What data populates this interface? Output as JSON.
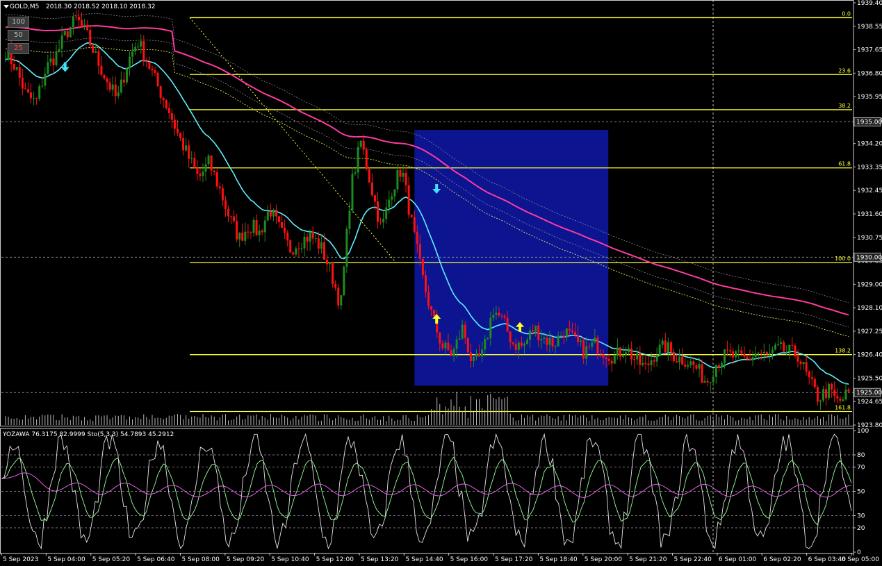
{
  "header": {
    "symbol": "GOLD,M5",
    "ohlc": "2018.30 2018.52 2018.10 2018.32"
  },
  "buttons": [
    {
      "label": "100",
      "color": "#999999"
    },
    {
      "label": "50",
      "color": "#999999"
    },
    {
      "label": "25",
      "color": "#ff4444"
    }
  ],
  "sub_header": {
    "text": "YOZAWA 76.3175 82.9999  Sto(5,3,3) 54.7893 45.2912"
  },
  "colors": {
    "bull": "#1f8a1f",
    "bear": "#ff1010",
    "fib": "#ffff33",
    "ma_fast": "#5ff0ff",
    "ma_slow": "#ff3aa0",
    "box": "#0c1490",
    "sto_main": "#9cff9c",
    "sto_signal": "#ff66ff",
    "osc": "#e6e6e6"
  },
  "chart_data": [
    {
      "type": "candlestick",
      "ylim": [
        1923.8,
        1939.4
      ],
      "y_ticks": [
        "1939.40",
        "1938.55",
        "1937.65",
        "1936.80",
        "1935.95",
        "1935.00",
        "1934.20",
        "1933.35",
        "1932.45",
        "1931.60",
        "1930.75",
        "1929.85",
        "1929.00",
        "1928.10",
        "1927.25",
        "1926.40",
        "1925.50",
        "1924.65",
        "1923.80"
      ],
      "price_boxes": [
        "1935.00",
        "1930.00",
        "1925.00"
      ],
      "x_ticks": [
        "5 Sep 2023",
        "5 Sep 04:00",
        "5 Sep 05:20",
        "5 Sep 06:40",
        "5 Sep 08:00",
        "5 Sep 09:20",
        "5 Sep 10:40",
        "5 Sep 12:00",
        "5 Sep 13:20",
        "5 Sep 14:40",
        "5 Sep 16:00",
        "5 Sep 17:20",
        "5 Sep 18:40",
        "5 Sep 20:00",
        "5 Sep 21:20",
        "5 Sep 22:40",
        "6 Sep 01:00",
        "6 Sep 02:20",
        "6 Sep 03:40",
        "6 Sep 05:00"
      ],
      "fib_levels": [
        {
          "label": "0.0",
          "price": 1938.85
        },
        {
          "label": "23.6",
          "price": 1936.75
        },
        {
          "label": "38.2",
          "price": 1935.45
        },
        {
          "label": "61.8",
          "price": 1933.3
        },
        {
          "label": "100.0",
          "price": 1929.8
        },
        {
          "label": "138.2",
          "price": 1926.4
        },
        {
          "label": "161.8",
          "price": 1924.3
        }
      ],
      "zone": {
        "price_top": 1934.7,
        "price_bottom": 1925.25
      },
      "path_points": [
        [
          1937.6,
          1937.45
        ],
        [
          1937.0,
          1937.2
        ],
        [
          1936.0,
          1936.2
        ],
        [
          1935.7,
          1935.9
        ],
        [
          1937.0,
          1937.3
        ],
        [
          1937.5,
          1937.7
        ],
        [
          1938.3,
          1938.5
        ],
        [
          1938.8,
          1938.9
        ],
        [
          1938.2,
          1938.0
        ],
        [
          1937.3,
          1937.1
        ],
        [
          1936.5,
          1936.4
        ],
        [
          1935.8,
          1935.7
        ],
        [
          1937.2,
          1937.4
        ],
        [
          1938.0,
          1938.1
        ],
        [
          1937.2,
          1937.0
        ],
        [
          1936.3,
          1936.1
        ],
        [
          1935.5,
          1935.3
        ],
        [
          1934.5,
          1934.3
        ],
        [
          1933.7,
          1933.5
        ],
        [
          1932.9,
          1932.8
        ],
        [
          1933.5,
          1933.6
        ],
        [
          1932.6,
          1932.4
        ],
        [
          1931.5,
          1931.3
        ],
        [
          1930.7,
          1930.5
        ],
        [
          1931.2,
          1931.4
        ],
        [
          1930.9,
          1930.6
        ],
        [
          1931.8,
          1931.9
        ],
        [
          1931.0,
          1930.8
        ],
        [
          1930.3,
          1930.1
        ],
        [
          1930.6,
          1930.7
        ],
        [
          1930.8,
          1930.9
        ],
        [
          1930.4,
          1930.3
        ],
        [
          1929.5,
          1929.3
        ],
        [
          1928.2,
          1928.0
        ],
        [
          1932.6,
          1932.9
        ],
        [
          1934.3,
          1934.1
        ],
        [
          1932.6,
          1932.5
        ],
        [
          1931.0,
          1930.8
        ],
        [
          1932.5,
          1932.7
        ],
        [
          1933.3,
          1933.2
        ],
        [
          1931.2,
          1931.0
        ],
        [
          1929.3,
          1929.1
        ],
        [
          1927.8,
          1927.6
        ],
        [
          1926.7,
          1926.5
        ],
        [
          1926.4,
          1926.3
        ],
        [
          1927.4,
          1927.6
        ],
        [
          1926.0,
          1925.8
        ],
        [
          1926.4,
          1926.6
        ],
        [
          1928.1,
          1928.3
        ],
        [
          1927.6,
          1927.7
        ],
        [
          1926.8,
          1926.9
        ],
        [
          1926.7,
          1926.8
        ],
        [
          1927.4,
          1927.5
        ],
        [
          1927.0,
          1927.1
        ],
        [
          1926.8,
          1926.9
        ],
        [
          1927.3,
          1927.4
        ],
        [
          1926.9,
          1926.8
        ],
        [
          1926.5,
          1926.6
        ],
        [
          1926.8,
          1926.7
        ],
        [
          1926.5,
          1926.4
        ],
        [
          1926.3,
          1926.4
        ],
        [
          1926.7,
          1926.9
        ],
        [
          1926.2,
          1926.1
        ],
        [
          1925.9,
          1926.0
        ],
        [
          1926.5,
          1926.6
        ],
        [
          1926.7,
          1926.9
        ],
        [
          1926.3,
          1926.2
        ],
        [
          1926.2,
          1926.3
        ],
        [
          1925.9,
          1925.8
        ],
        [
          1925.4,
          1925.5
        ],
        [
          1926.1,
          1926.2
        ],
        [
          1926.4,
          1926.5
        ],
        [
          1926.3,
          1926.4
        ],
        [
          1926.2,
          1926.3
        ],
        [
          1926.5,
          1926.6
        ],
        [
          1926.3,
          1926.4
        ],
        [
          1926.6,
          1926.7
        ],
        [
          1926.5,
          1926.4
        ],
        [
          1926.4,
          1926.5
        ],
        [
          1925.5,
          1925.4
        ],
        [
          1924.8,
          1924.9
        ],
        [
          1925.1,
          1925.2
        ],
        [
          1924.6,
          1924.7
        ],
        [
          1925.0,
          1925.2
        ]
      ],
      "arrows": [
        {
          "bar_frac": 0.075,
          "price": 1937.05,
          "dir": "down",
          "color": "#40e0ff"
        },
        {
          "bar_frac": 0.512,
          "price": 1932.55,
          "dir": "down",
          "color": "#40e0ff"
        },
        {
          "bar_frac": 0.512,
          "price": 1927.7,
          "dir": "up",
          "color": "#ffff22"
        },
        {
          "bar_frac": 0.61,
          "price": 1927.4,
          "dir": "up",
          "color": "#ffff22"
        }
      ]
    },
    {
      "type": "line",
      "name": "oscillator",
      "ylim": [
        0,
        100
      ],
      "y_ticks": [
        "100",
        "80",
        "70",
        "50",
        "30",
        "20",
        "0"
      ],
      "levels": [
        80,
        70,
        50,
        30,
        20
      ]
    }
  ]
}
